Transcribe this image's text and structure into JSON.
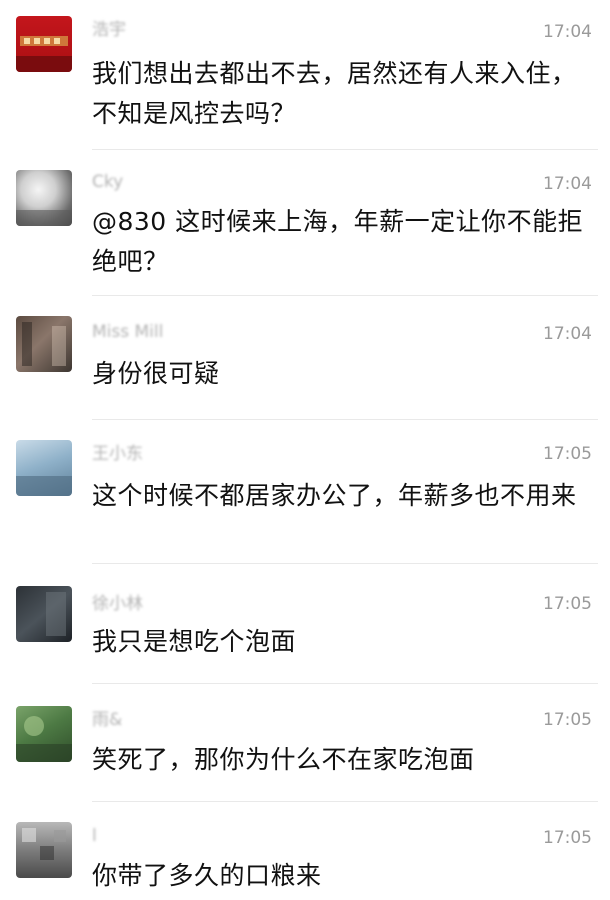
{
  "messages": [
    {
      "name": "浩宇",
      "time": "17:04",
      "text": "我们想出去都出不去，居然还有人来入住，不知是风控去吗？",
      "avatar": "avatar-red-banner-icon"
    },
    {
      "name": "Cky",
      "time": "17:04",
      "text": "@830  这时候来上海，年薪一定让你不能拒绝吧？",
      "avatar": "avatar-photo-icon"
    },
    {
      "name": "Miss Mill",
      "time": "17:04",
      "text": "身份很可疑",
      "avatar": "avatar-photo-icon"
    },
    {
      "name": "王小东",
      "time": "17:05",
      "text": "这个时候不都居家办公了，年薪多也不用来",
      "avatar": "avatar-photo-icon"
    },
    {
      "name": "徐小林",
      "time": "17:05",
      "text": "我只是想吃个泡面",
      "avatar": "avatar-photo-icon"
    },
    {
      "name": "雨&",
      "time": "17:05",
      "text": "笑死了，那你为什么不在家吃泡面",
      "avatar": "avatar-photo-icon"
    },
    {
      "name": "l",
      "time": "17:05",
      "text": "你带了多久的口粮来",
      "avatar": "avatar-photo-icon"
    }
  ]
}
